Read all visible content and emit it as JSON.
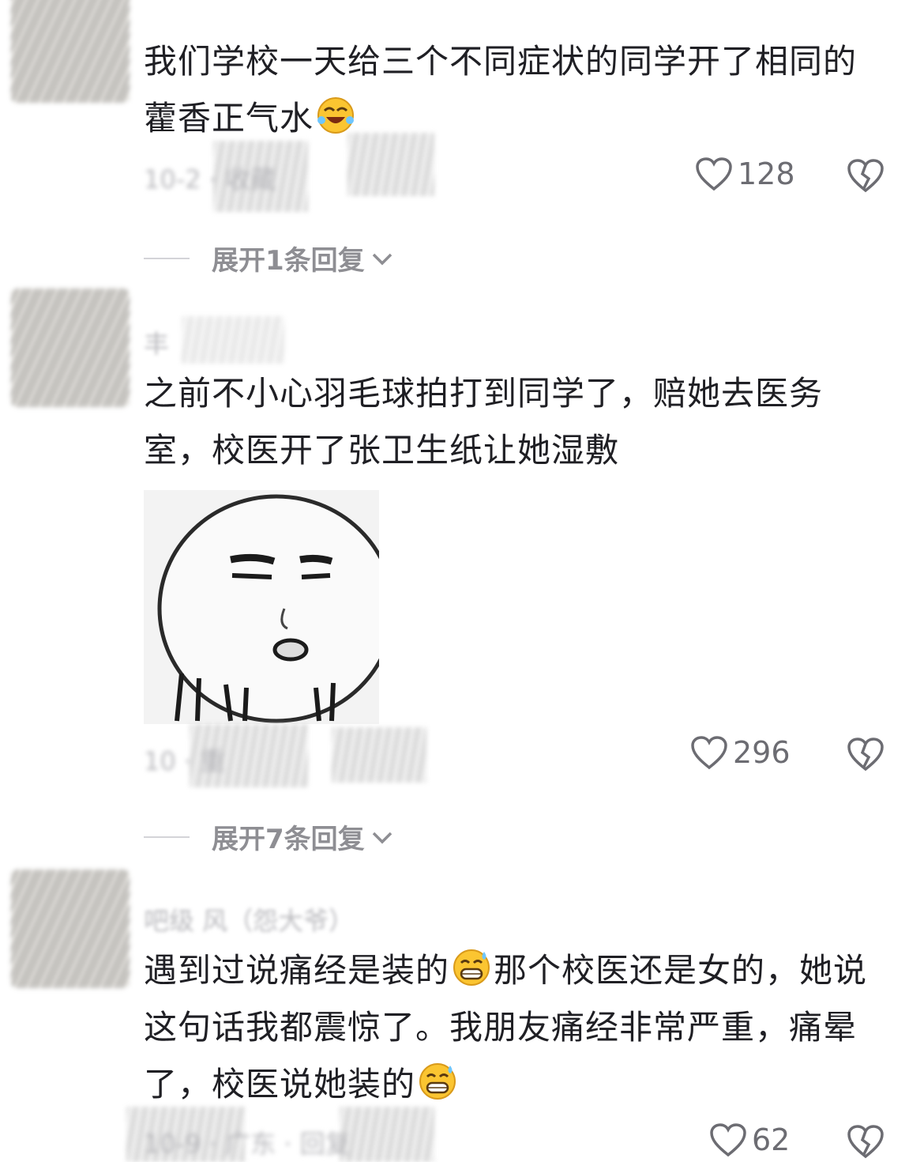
{
  "comments": [
    {
      "username": "",
      "text": "我们学校一天给三个不同症状的同学开了相同的藿香正气水",
      "meta": "10-2 · 收藏",
      "likes": "128",
      "replies_label": "展开1条回复"
    },
    {
      "username": "丰",
      "text": "之前不小心羽毛球拍打到同学了，赔她去医务室，校医开了张卫生纸让她湿敷",
      "meta": "10 · 重",
      "likes": "296",
      "replies_label": "展开7条回复"
    },
    {
      "username": "吧级 风（怨大爷）",
      "text_part1": "遇到过说痛经是装的",
      "text_part2": "那个校医还是女的，她说这句话我都震惊了。我朋友痛经非常严重，痛晕了，校医说她装的",
      "meta": "10-9 · 广东 · 回复",
      "likes": "62"
    }
  ],
  "icons": {
    "like": "heart-outline-icon",
    "dislike": "broken-heart-icon",
    "emoji_laugh": "laughing-tears-emoji",
    "emoji_sweat": "grin-sweat-emoji",
    "chevron": "chevron-down-icon"
  }
}
